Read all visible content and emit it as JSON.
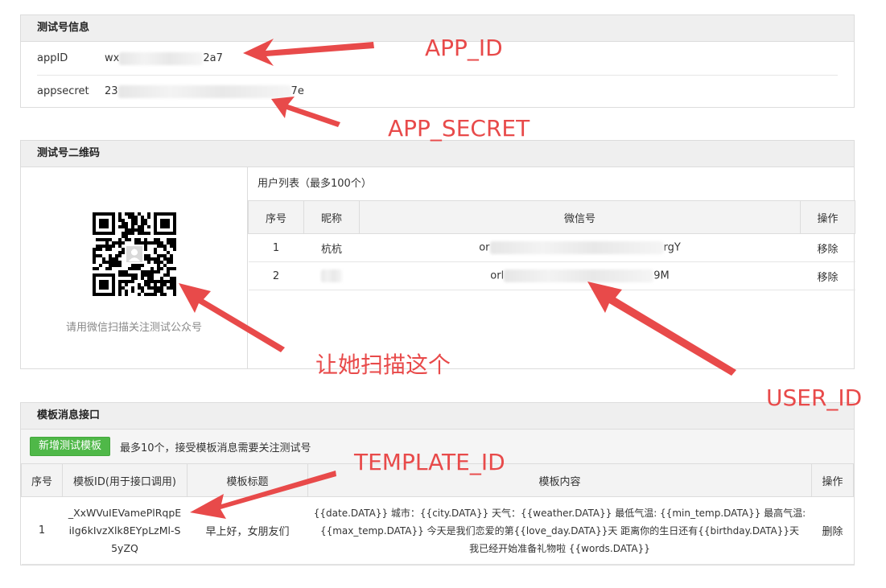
{
  "test_account": {
    "header": "测试号信息",
    "appid_label": "appID",
    "appid_prefix": "wx",
    "appid_suffix": "2a7",
    "secret_label": "appsecret",
    "secret_prefix": "23",
    "secret_suffix": "7e"
  },
  "qrcode": {
    "header": "测试号二维码",
    "caption": "请用微信扫描关注测试公众号"
  },
  "user_list": {
    "title": "用户列表（最多100个）",
    "columns": [
      "序号",
      "昵称",
      "微信号",
      "操作"
    ],
    "rows": [
      {
        "index": "1",
        "nickname": "杭杭",
        "wxid_prefix": "or",
        "wxid_suffix": "rgY",
        "action": "移除"
      },
      {
        "index": "2",
        "nickname": "",
        "wxid_prefix": "orl",
        "wxid_suffix": "9M",
        "action": "移除"
      }
    ]
  },
  "template": {
    "header": "模板消息接口",
    "add_button": "新增测试模板",
    "note": "最多10个，接受模板消息需要关注测试号",
    "columns": [
      "序号",
      "模板ID(用于接口调用)",
      "模板标题",
      "模板内容",
      "操作"
    ],
    "rows": [
      {
        "index": "1",
        "id_line1": "_XxWVuIEVamePlRqpE",
        "id_line2": "iIg6kIvzXlk8EYpLzMl-S",
        "id_line3": "5yZQ",
        "title": "早上好，女朋友们",
        "content_line1": "{{date.DATA}} 城市：{{city.DATA}} 天气：{{weather.DATA}} 最低气温: {{min_temp.DATA}} 最高气温:",
        "content_line2": "{{max_temp.DATA}} 今天是我们恋爱的第{{love_day.DATA}}天 距离你的生日还有{{birthday.DATA}}天",
        "content_line3": "我已经开始准备礼物啦 {{words.DATA}}",
        "action": "删除"
      }
    ]
  },
  "annotations": {
    "app_id": "APP_ID",
    "app_secret": "APP_SECRET",
    "scan": "让她扫描这个",
    "user_id": "USER_ID",
    "template_id": "TEMPLATE_ID"
  },
  "colors": {
    "annotation": "#e84a4a",
    "link": "#3a8ee6",
    "button": "#4fb848"
  }
}
